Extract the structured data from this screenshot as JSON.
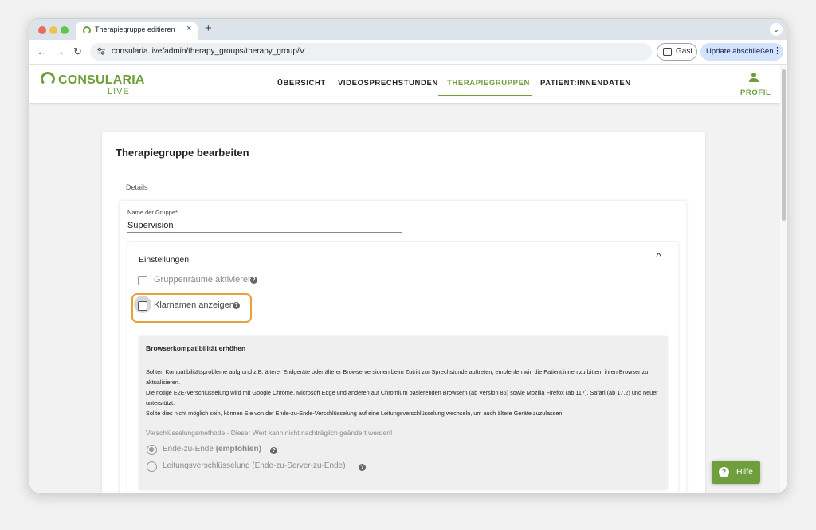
{
  "browser": {
    "tab_title": "Therapiegruppe editieren",
    "tab_close": "×",
    "new_tab": "+",
    "tab_menu": "⌄",
    "back": "←",
    "forward": "→",
    "reload": "↻",
    "url": "consularia.live/admin/therapy_groups/therapy_group/V",
    "guest_label": "Gast",
    "update_label": "Update abschließen",
    "menu_dots": "⋮",
    "traffic_lights": [
      "#ed6a5e",
      "#f5bf4f",
      "#61c554"
    ]
  },
  "brand": {
    "name": "CONSULARIA",
    "sub": "LIVE",
    "color": "#6e9f3c"
  },
  "nav": {
    "items": [
      {
        "label": "ÜBERSICHT"
      },
      {
        "label": "VIDEOSPRECHSTUNDEN"
      },
      {
        "label": "THERAPIEGRUPPEN",
        "active": true
      },
      {
        "label": "PATIENT:INNENDATEN"
      }
    ],
    "profile_label": "PROFIL"
  },
  "page": {
    "title": "Therapiegruppe bearbeiten",
    "section": "Details",
    "group_name_label": "Name der Gruppe*",
    "group_name_value": "Supervision"
  },
  "settings": {
    "title": "Einstellungen",
    "chevron": "^",
    "group_rooms": {
      "label": "Gruppenräume aktivieren",
      "checked": false
    },
    "show_names": {
      "label": "Klarnamen anzeigen",
      "checked": false
    },
    "help_glyph": "?"
  },
  "compat": {
    "title": "Browserkompatibilität erhöhen",
    "paragraphs": [
      "Sollten Kompatibilitätsprobleme aufgrund z.B. älterer Endgeräte oder älterer Browserversionen beim Zutritt zur Sprechstunde auftreten, empfehlen wir, die Patient:innen zu bitten, ihren Browser zu aktualisieren.",
      "Die nötige E2E-Verschlüsselung wird mit Google Chrome, Microsoft Edge und anderen auf Chromium basierenden Browsern (ab Version 86) sowie Mozilla Firefox (ab 117), Safari (ab 17.2) und neuer unterstützt.",
      "Sollte dies nicht möglich sein, können Sie von der Ende-zu-Ende-Verschlüsselung auf eine Leitungsverschlüsselung wechseln, um auch ältere Geräte zuzulassen."
    ],
    "method_label": "Verschlüsselungsmethode - Dieser Wert kann nicht nachträglich geändert werden!",
    "options": [
      {
        "label": "Ende-zu-Ende",
        "suffix": "(empfohlen)",
        "selected": true
      },
      {
        "label": "Leitungsverschlüsselung (Ende-zu-Server-zu-Ende)",
        "selected": false
      }
    ]
  },
  "help_button": {
    "label": "Hilfe",
    "glyph": "?"
  }
}
